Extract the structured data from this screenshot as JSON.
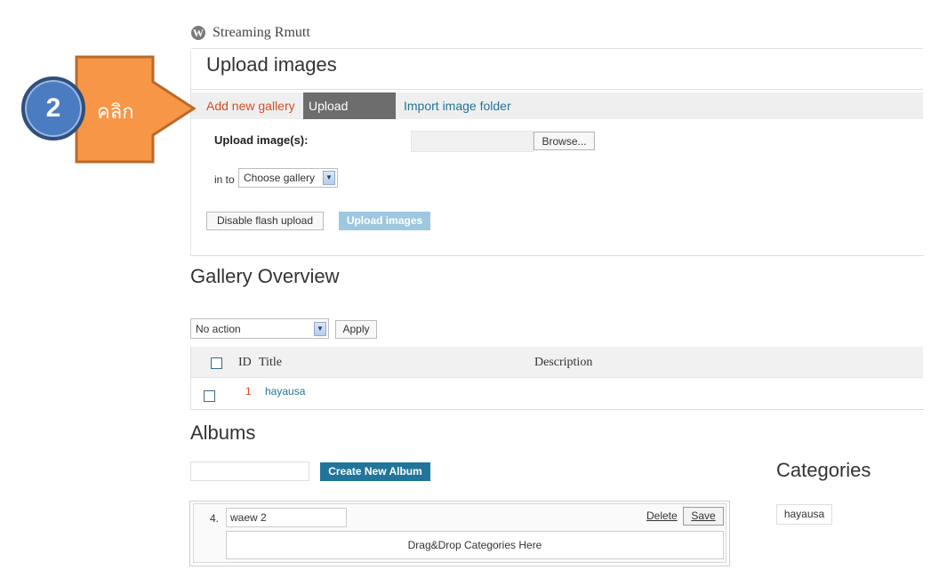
{
  "site": {
    "title": "Streaming Rmutt",
    "logo_glyph": "W"
  },
  "upload": {
    "heading": "Upload images",
    "tabs": {
      "add_gallery": "Add new gallery",
      "upload_images": "Upload Images",
      "import_folder": "Import image folder"
    },
    "upload_label": "Upload image(s):",
    "browse_label": "Browse...",
    "into_label": "in to",
    "gallery_select_value": "Choose gallery",
    "disable_flash_label": "Disable flash upload",
    "upload_button_label": "Upload images"
  },
  "gallery": {
    "heading": "Gallery Overview",
    "bulk_action_value": "No action",
    "apply_label": "Apply",
    "columns": {
      "id": "ID",
      "title": "Title",
      "description": "Description"
    },
    "rows": [
      {
        "id": "1",
        "title": "hayausa",
        "description": ""
      }
    ]
  },
  "albums": {
    "heading": "Albums",
    "create_label": "Create New Album",
    "items": [
      {
        "number": "4.",
        "name": "waew 2",
        "delete_label": "Delete",
        "save_label": "Save",
        "drop_text": "Drag&Drop Categories Here"
      }
    ]
  },
  "categories": {
    "heading": "Categories",
    "items": [
      "hayausa"
    ]
  },
  "annotation": {
    "step_number": "2",
    "callout_text": "คลิก",
    "callout_color": "#f79646",
    "badge_color": "#4b7cc2"
  }
}
